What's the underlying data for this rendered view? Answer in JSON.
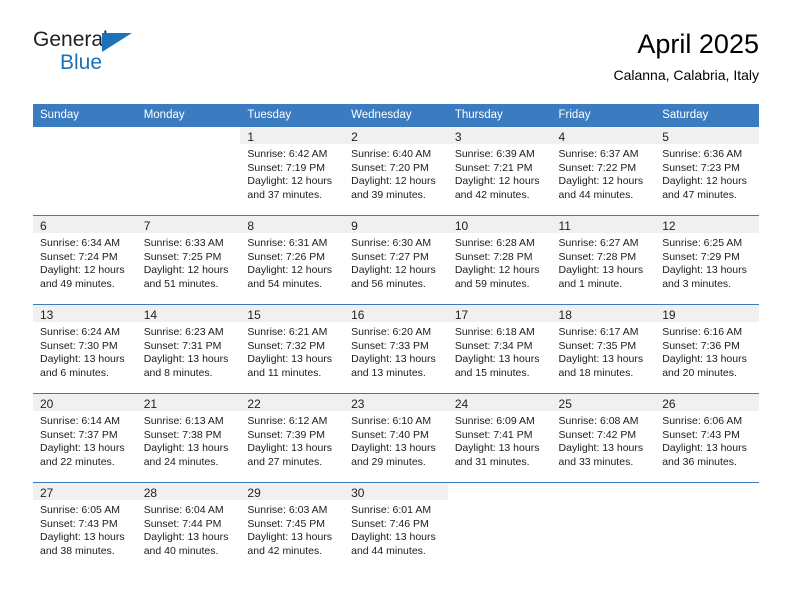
{
  "brand": {
    "name_top": "General",
    "name_bottom": "Blue"
  },
  "header": {
    "title": "April 2025",
    "subtitle": "Calanna, Calabria, Italy"
  },
  "colors": {
    "header_blue": "#3a7cbf",
    "brand_blue": "#1a72b8",
    "daynum_band": "#f0f0f0",
    "text": "#1c1c1c"
  },
  "weekdays": [
    "Sunday",
    "Monday",
    "Tuesday",
    "Wednesday",
    "Thursday",
    "Friday",
    "Saturday"
  ],
  "weeks": [
    [
      {
        "day": "",
        "sunrise": "",
        "sunset": "",
        "daylight1": "",
        "daylight2": ""
      },
      {
        "day": "",
        "sunrise": "",
        "sunset": "",
        "daylight1": "",
        "daylight2": ""
      },
      {
        "day": "1",
        "sunrise": "Sunrise: 6:42 AM",
        "sunset": "Sunset: 7:19 PM",
        "daylight1": "Daylight: 12 hours",
        "daylight2": "and 37 minutes."
      },
      {
        "day": "2",
        "sunrise": "Sunrise: 6:40 AM",
        "sunset": "Sunset: 7:20 PM",
        "daylight1": "Daylight: 12 hours",
        "daylight2": "and 39 minutes."
      },
      {
        "day": "3",
        "sunrise": "Sunrise: 6:39 AM",
        "sunset": "Sunset: 7:21 PM",
        "daylight1": "Daylight: 12 hours",
        "daylight2": "and 42 minutes."
      },
      {
        "day": "4",
        "sunrise": "Sunrise: 6:37 AM",
        "sunset": "Sunset: 7:22 PM",
        "daylight1": "Daylight: 12 hours",
        "daylight2": "and 44 minutes."
      },
      {
        "day": "5",
        "sunrise": "Sunrise: 6:36 AM",
        "sunset": "Sunset: 7:23 PM",
        "daylight1": "Daylight: 12 hours",
        "daylight2": "and 47 minutes."
      }
    ],
    [
      {
        "day": "6",
        "sunrise": "Sunrise: 6:34 AM",
        "sunset": "Sunset: 7:24 PM",
        "daylight1": "Daylight: 12 hours",
        "daylight2": "and 49 minutes."
      },
      {
        "day": "7",
        "sunrise": "Sunrise: 6:33 AM",
        "sunset": "Sunset: 7:25 PM",
        "daylight1": "Daylight: 12 hours",
        "daylight2": "and 51 minutes."
      },
      {
        "day": "8",
        "sunrise": "Sunrise: 6:31 AM",
        "sunset": "Sunset: 7:26 PM",
        "daylight1": "Daylight: 12 hours",
        "daylight2": "and 54 minutes."
      },
      {
        "day": "9",
        "sunrise": "Sunrise: 6:30 AM",
        "sunset": "Sunset: 7:27 PM",
        "daylight1": "Daylight: 12 hours",
        "daylight2": "and 56 minutes."
      },
      {
        "day": "10",
        "sunrise": "Sunrise: 6:28 AM",
        "sunset": "Sunset: 7:28 PM",
        "daylight1": "Daylight: 12 hours",
        "daylight2": "and 59 minutes."
      },
      {
        "day": "11",
        "sunrise": "Sunrise: 6:27 AM",
        "sunset": "Sunset: 7:28 PM",
        "daylight1": "Daylight: 13 hours",
        "daylight2": "and 1 minute."
      },
      {
        "day": "12",
        "sunrise": "Sunrise: 6:25 AM",
        "sunset": "Sunset: 7:29 PM",
        "daylight1": "Daylight: 13 hours",
        "daylight2": "and 3 minutes."
      }
    ],
    [
      {
        "day": "13",
        "sunrise": "Sunrise: 6:24 AM",
        "sunset": "Sunset: 7:30 PM",
        "daylight1": "Daylight: 13 hours",
        "daylight2": "and 6 minutes."
      },
      {
        "day": "14",
        "sunrise": "Sunrise: 6:23 AM",
        "sunset": "Sunset: 7:31 PM",
        "daylight1": "Daylight: 13 hours",
        "daylight2": "and 8 minutes."
      },
      {
        "day": "15",
        "sunrise": "Sunrise: 6:21 AM",
        "sunset": "Sunset: 7:32 PM",
        "daylight1": "Daylight: 13 hours",
        "daylight2": "and 11 minutes."
      },
      {
        "day": "16",
        "sunrise": "Sunrise: 6:20 AM",
        "sunset": "Sunset: 7:33 PM",
        "daylight1": "Daylight: 13 hours",
        "daylight2": "and 13 minutes."
      },
      {
        "day": "17",
        "sunrise": "Sunrise: 6:18 AM",
        "sunset": "Sunset: 7:34 PM",
        "daylight1": "Daylight: 13 hours",
        "daylight2": "and 15 minutes."
      },
      {
        "day": "18",
        "sunrise": "Sunrise: 6:17 AM",
        "sunset": "Sunset: 7:35 PM",
        "daylight1": "Daylight: 13 hours",
        "daylight2": "and 18 minutes."
      },
      {
        "day": "19",
        "sunrise": "Sunrise: 6:16 AM",
        "sunset": "Sunset: 7:36 PM",
        "daylight1": "Daylight: 13 hours",
        "daylight2": "and 20 minutes."
      }
    ],
    [
      {
        "day": "20",
        "sunrise": "Sunrise: 6:14 AM",
        "sunset": "Sunset: 7:37 PM",
        "daylight1": "Daylight: 13 hours",
        "daylight2": "and 22 minutes."
      },
      {
        "day": "21",
        "sunrise": "Sunrise: 6:13 AM",
        "sunset": "Sunset: 7:38 PM",
        "daylight1": "Daylight: 13 hours",
        "daylight2": "and 24 minutes."
      },
      {
        "day": "22",
        "sunrise": "Sunrise: 6:12 AM",
        "sunset": "Sunset: 7:39 PM",
        "daylight1": "Daylight: 13 hours",
        "daylight2": "and 27 minutes."
      },
      {
        "day": "23",
        "sunrise": "Sunrise: 6:10 AM",
        "sunset": "Sunset: 7:40 PM",
        "daylight1": "Daylight: 13 hours",
        "daylight2": "and 29 minutes."
      },
      {
        "day": "24",
        "sunrise": "Sunrise: 6:09 AM",
        "sunset": "Sunset: 7:41 PM",
        "daylight1": "Daylight: 13 hours",
        "daylight2": "and 31 minutes."
      },
      {
        "day": "25",
        "sunrise": "Sunrise: 6:08 AM",
        "sunset": "Sunset: 7:42 PM",
        "daylight1": "Daylight: 13 hours",
        "daylight2": "and 33 minutes."
      },
      {
        "day": "26",
        "sunrise": "Sunrise: 6:06 AM",
        "sunset": "Sunset: 7:43 PM",
        "daylight1": "Daylight: 13 hours",
        "daylight2": "and 36 minutes."
      }
    ],
    [
      {
        "day": "27",
        "sunrise": "Sunrise: 6:05 AM",
        "sunset": "Sunset: 7:43 PM",
        "daylight1": "Daylight: 13 hours",
        "daylight2": "and 38 minutes."
      },
      {
        "day": "28",
        "sunrise": "Sunrise: 6:04 AM",
        "sunset": "Sunset: 7:44 PM",
        "daylight1": "Daylight: 13 hours",
        "daylight2": "and 40 minutes."
      },
      {
        "day": "29",
        "sunrise": "Sunrise: 6:03 AM",
        "sunset": "Sunset: 7:45 PM",
        "daylight1": "Daylight: 13 hours",
        "daylight2": "and 42 minutes."
      },
      {
        "day": "30",
        "sunrise": "Sunrise: 6:01 AM",
        "sunset": "Sunset: 7:46 PM",
        "daylight1": "Daylight: 13 hours",
        "daylight2": "and 44 minutes."
      },
      {
        "day": "",
        "sunrise": "",
        "sunset": "",
        "daylight1": "",
        "daylight2": ""
      },
      {
        "day": "",
        "sunrise": "",
        "sunset": "",
        "daylight1": "",
        "daylight2": ""
      },
      {
        "day": "",
        "sunrise": "",
        "sunset": "",
        "daylight1": "",
        "daylight2": ""
      }
    ]
  ]
}
